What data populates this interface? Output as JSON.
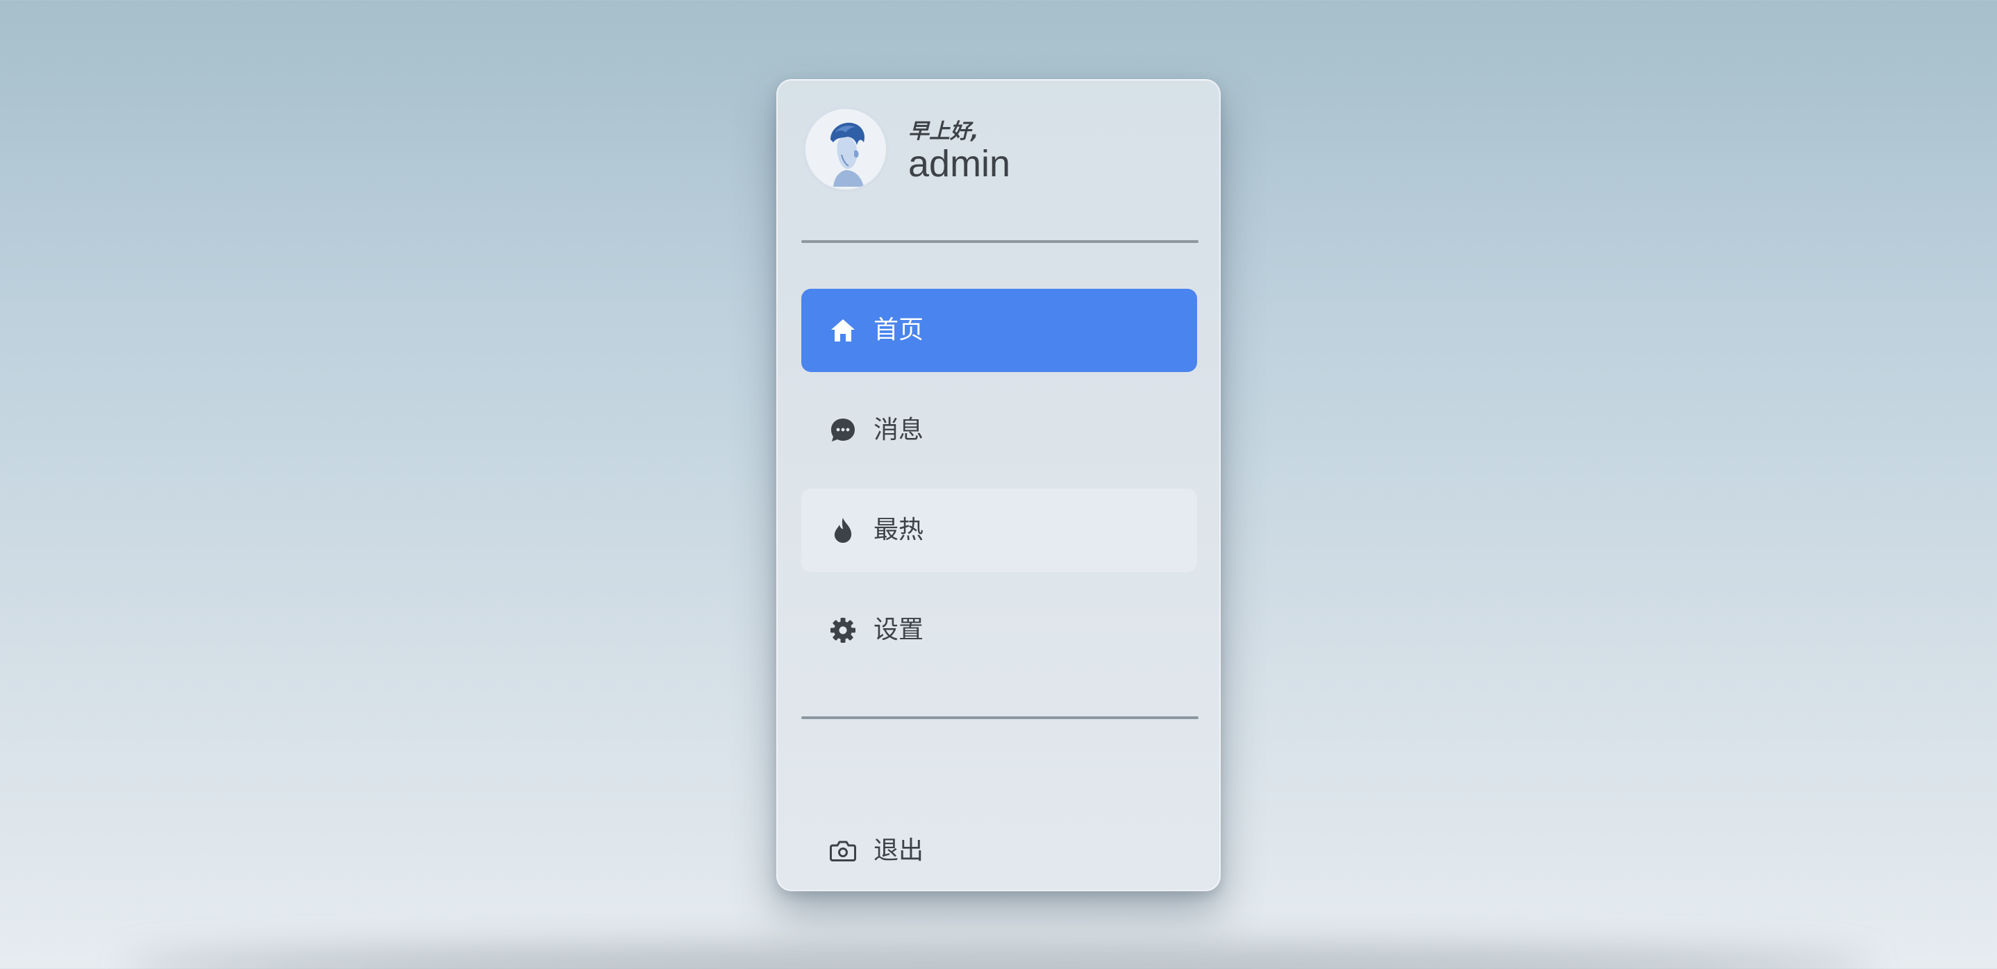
{
  "profile": {
    "greeting": "早上好,",
    "username": "admin"
  },
  "menu": {
    "items": [
      {
        "label": "首页",
        "icon": "home-icon",
        "active": true
      },
      {
        "label": "消息",
        "icon": "chat-icon",
        "active": false
      },
      {
        "label": "最热",
        "icon": "fire-icon",
        "active": false
      },
      {
        "label": "设置",
        "icon": "gear-icon",
        "active": false
      }
    ]
  },
  "footer": {
    "logout_label": "退出",
    "logout_icon": "camera-icon"
  },
  "colors": {
    "accent": "#4a84ee",
    "text": "#3d4248",
    "divider": "#8c979f"
  }
}
